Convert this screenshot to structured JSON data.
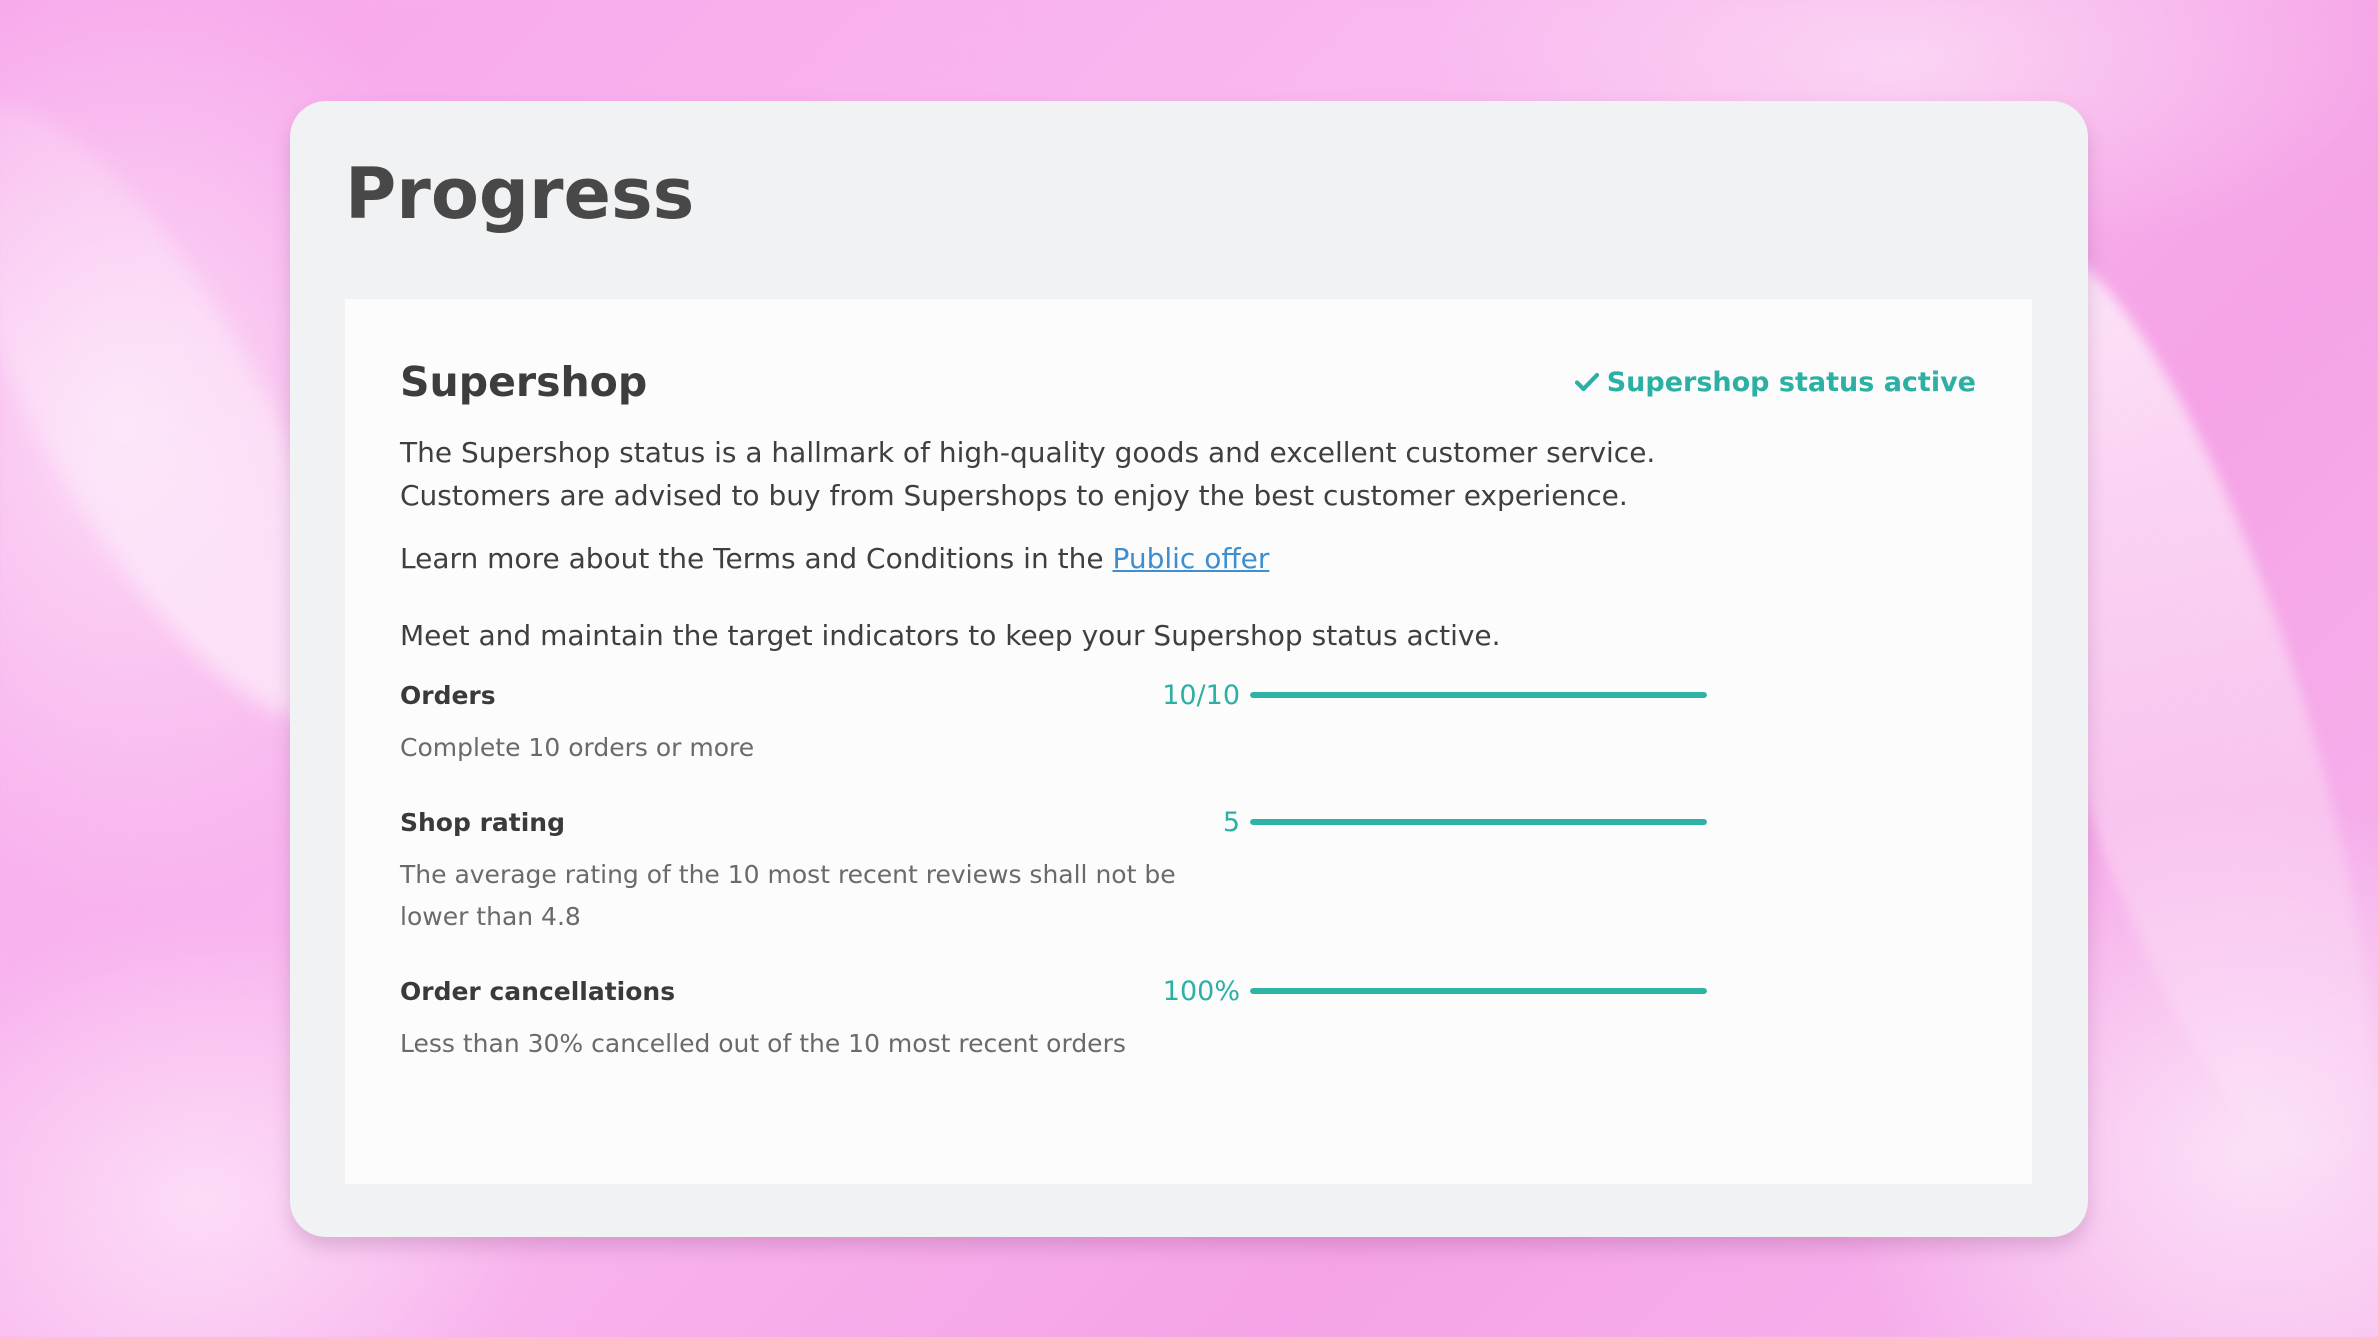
{
  "page": {
    "title": "Progress"
  },
  "supershop": {
    "title": "Supershop",
    "status": {
      "label": "Supershop status active",
      "icon": "check-icon",
      "color": "#2cb0a4"
    },
    "description_line1": "The Supershop status is a hallmark of high-quality goods and excellent customer service.",
    "description_line2": "Customers are advised to buy from Supershops to enjoy the best customer experience.",
    "learn_more_prefix": "Learn more about the Terms and Conditions in the ",
    "learn_more_link": "Public offer",
    "intro": "Meet and maintain the target indicators to keep your Supershop status active.",
    "indicators": [
      {
        "label": "Orders",
        "value": "10/10",
        "progress_percent": 100,
        "description": "Complete 10 orders or more"
      },
      {
        "label": "Shop rating",
        "value": "5",
        "progress_percent": 100,
        "description": "The average rating of the 10 most recent reviews shall not be lower than 4.8"
      },
      {
        "label": "Order cancellations",
        "value": "100%",
        "progress_percent": 100,
        "description": "Less than 30% cancelled out of the 10 most recent orders"
      }
    ]
  },
  "colors": {
    "accent": "#2cb0a4",
    "link": "#3d8fd1",
    "background": "#f7a5ea"
  }
}
